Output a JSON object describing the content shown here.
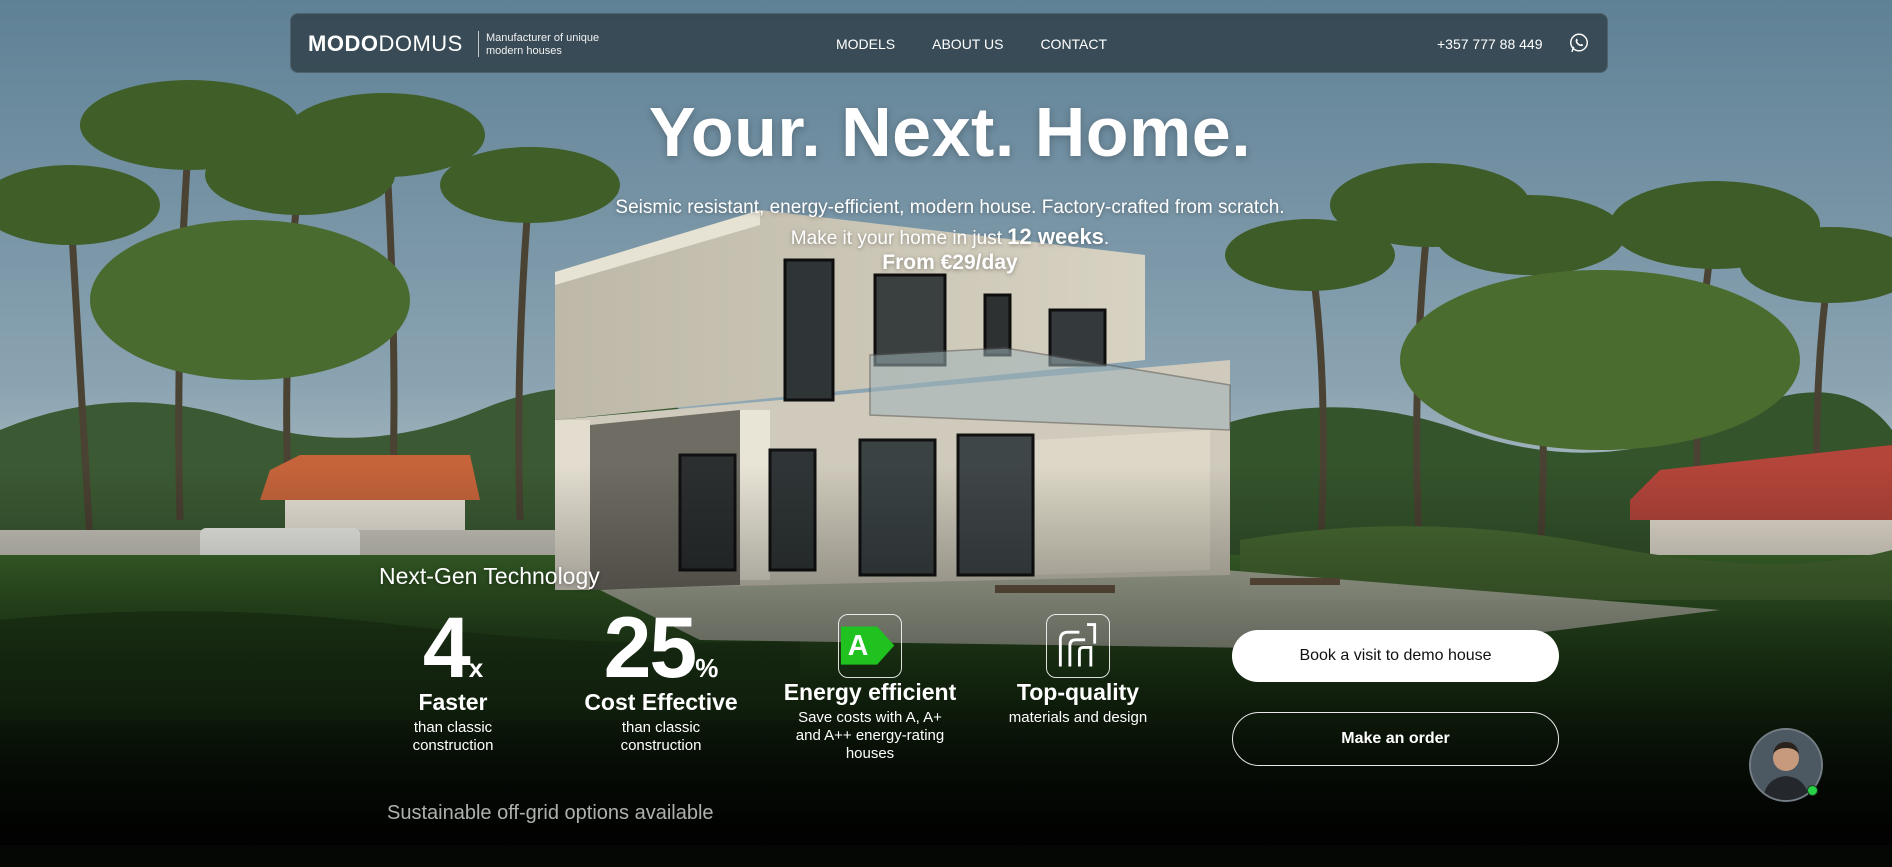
{
  "header": {
    "logo_part1": "MODO",
    "logo_part2": "DOMUS",
    "tagline": "Manufacturer of unique modern houses",
    "nav": [
      "MODELS",
      "ABOUT US",
      "CONTACT"
    ],
    "phone": "+357 777 88 449",
    "whatsapp_icon": "whatsapp-icon"
  },
  "hero": {
    "title": "Your. Next. Home.",
    "subtitle_line1": "Seismic resistant, energy-efficient, modern house. Factory-crafted from scratch.",
    "subtitle_line2_prefix": "Make it your home in just ",
    "subtitle_line2_bold": "12 weeks",
    "subtitle_line2_suffix": ".",
    "price": "From €29/day"
  },
  "tech": {
    "heading": "Next-Gen Technology",
    "features": [
      {
        "big": "4",
        "suffix": "x",
        "title": "Faster",
        "desc": "than classic construction"
      },
      {
        "big": "25",
        "suffix": "%",
        "title": "Cost Effective",
        "desc": "than classic construction"
      },
      {
        "icon": "energy-rating-a-icon",
        "badge": "A",
        "title": "Energy efficient",
        "desc": "Save costs with A, A+ and A++ energy-rating houses"
      },
      {
        "icon": "quality-icon",
        "title": "Top-quality",
        "desc": "materials and design"
      }
    ],
    "offgrid": "Sustainable off-grid options available"
  },
  "cta": {
    "book_label": "Book a visit to demo house",
    "order_label": "Make an order"
  },
  "chat": {
    "avatar_icon": "chat-avatar"
  },
  "colors": {
    "header_bg": "#344650",
    "energy_green": "#1fc21f",
    "button_white": "#ffffff"
  }
}
